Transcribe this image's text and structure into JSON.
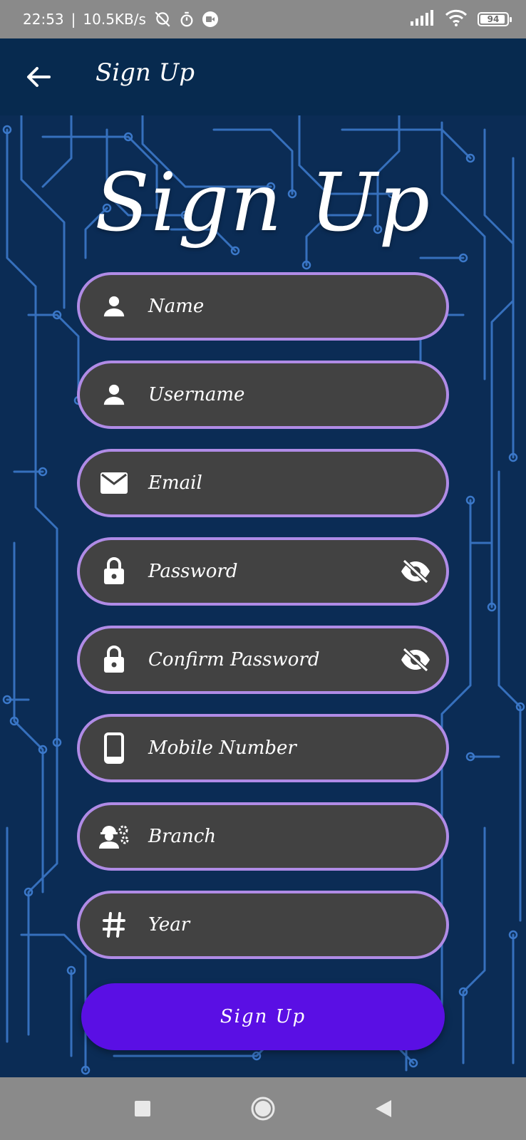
{
  "status_bar": {
    "time": "22:53",
    "separator": "|",
    "speed": "10.5KB/s",
    "battery_level": "94",
    "icons": [
      "alarm-off-icon",
      "timer-icon",
      "video-record-icon",
      "signal-icon",
      "wifi-icon",
      "battery-icon"
    ]
  },
  "app_bar": {
    "title": "Sign Up",
    "back_icon": "arrow-back-icon"
  },
  "hero": {
    "title": "Sign Up"
  },
  "fields": [
    {
      "label": "Name",
      "icon": "person-icon"
    },
    {
      "label": "Username",
      "icon": "person-icon"
    },
    {
      "label": "Email",
      "icon": "email-icon"
    },
    {
      "label": "Password",
      "icon": "lock-icon",
      "trailing": "visibility-off-icon"
    },
    {
      "label": "Confirm Password",
      "icon": "lock-icon",
      "trailing": "visibility-off-icon"
    },
    {
      "label": "Mobile Number",
      "icon": "smartphone-icon"
    },
    {
      "label": "Branch",
      "icon": "engineer-icon"
    },
    {
      "label": "Year",
      "icon": "hash-icon"
    }
  ],
  "submit": {
    "label": "Sign Up"
  },
  "nav_bar": {
    "buttons": [
      "recents-square-icon",
      "home-circle-icon",
      "back-triangle-icon"
    ]
  },
  "colors": {
    "background": "#0b2c55",
    "circuit": "#3b78c9",
    "field_bg": "#424242",
    "field_border": "#b08be6",
    "button": "#5a0fe4",
    "system_bars": "#8a8a8a"
  }
}
